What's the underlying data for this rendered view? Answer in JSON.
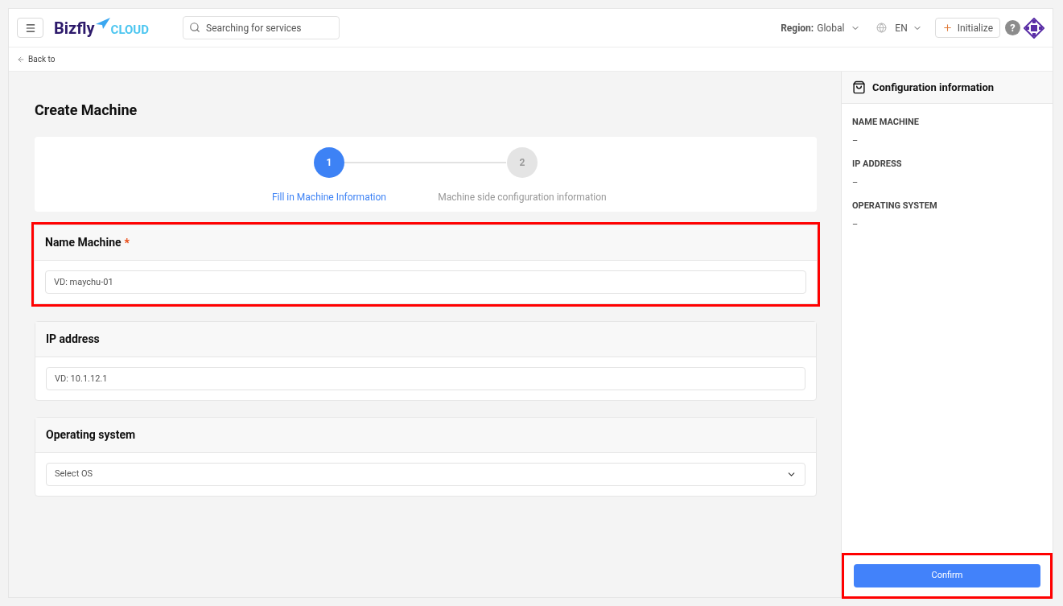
{
  "header": {
    "logo": {
      "brand": "Bizfly",
      "suffix": "CLOUD"
    },
    "search": {
      "placeholder": "Searching for services"
    },
    "region": {
      "label": "Region:",
      "value": "Global"
    },
    "language": "EN",
    "initialize_button": "Initialize",
    "help": "?"
  },
  "back_link": "Back to",
  "page_title": "Create Machine",
  "steps": [
    {
      "number": "1",
      "label": "Fill in Machine Information",
      "selected": true
    },
    {
      "number": "2",
      "label": "Machine side configuration information",
      "selected": false
    }
  ],
  "sections": [
    {
      "kind": "text",
      "title": "Name Machine",
      "required_mark": "*",
      "placeholder": "VD: maychu-01",
      "highlighted": true
    },
    {
      "kind": "text",
      "title": "IP address",
      "placeholder": "VD: 10.1.12.1",
      "highlighted": false
    },
    {
      "kind": "select",
      "title": "Operating system",
      "placeholder": "Select OS",
      "highlighted": false
    }
  ],
  "summary": {
    "title": "Configuration information",
    "items": [
      {
        "label": "NAME MACHINE",
        "value": "–"
      },
      {
        "label": "IP ADDRESS",
        "value": "–"
      },
      {
        "label": "OPERATING SYSTEM",
        "value": "–"
      }
    ],
    "confirm_button": "Confirm",
    "highlighted": true
  }
}
